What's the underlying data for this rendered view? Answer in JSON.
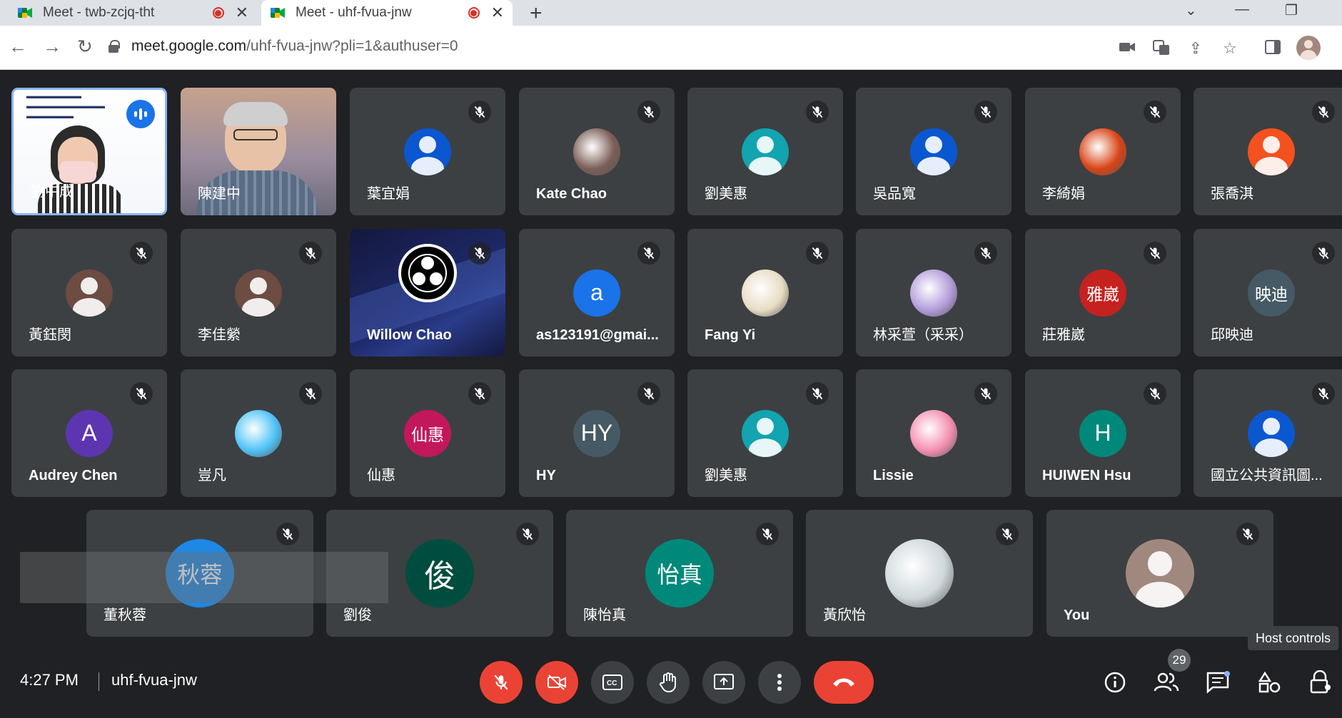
{
  "browser": {
    "tabs": [
      {
        "title": "Meet - twb-zcjq-tht",
        "active": false
      },
      {
        "title": "Meet - uhf-fvua-jnw",
        "active": true
      }
    ],
    "url_host": "meet.google.com",
    "url_path": "/uhf-fvua-jnw?pli=1&authuser=0"
  },
  "meeting": {
    "time": "4:27 PM",
    "code": "uhf-fvua-jnw",
    "participant_count": "29",
    "tooltip": "Host controls"
  },
  "colors": {
    "background": "#202124",
    "tile": "#3c4043",
    "accent": "#1a73e8",
    "danger": "#ea4335"
  },
  "participants": {
    "row1": [
      {
        "name": "劉中成",
        "kind": "video-slide",
        "speaking": true
      },
      {
        "name": "陳建中",
        "kind": "video-person"
      },
      {
        "name": "葉宜娟",
        "kind": "avatar",
        "color": "#0b57d0",
        "icon": "person-icon"
      },
      {
        "name": "Kate Chao",
        "kind": "photo",
        "color": "#7b5e57",
        "icon": "profile-photo-icon"
      },
      {
        "name": "劉美惠",
        "kind": "avatar",
        "color": "#12a4af",
        "icon": "person-icon"
      },
      {
        "name": "吳品寬",
        "kind": "avatar",
        "color": "#0b57d0",
        "icon": "person-icon"
      },
      {
        "name": "李綺娟",
        "kind": "photo",
        "color": "#d84315",
        "icon": "flower-photo-icon"
      },
      {
        "name": "張喬淇",
        "kind": "avatar",
        "color": "#f4511e",
        "icon": "person-icon"
      }
    ],
    "row2": [
      {
        "name": "黃鈺閔",
        "kind": "avatar",
        "color": "#6d4c41",
        "icon": "person-icon"
      },
      {
        "name": "李佳縈",
        "kind": "avatar",
        "color": "#6d4c41",
        "icon": "person-icon"
      },
      {
        "name": "Willow Chao",
        "kind": "obs",
        "icon": "obs-logo-icon"
      },
      {
        "name": "as123191@gmai...",
        "kind": "letter",
        "letter": "a",
        "color": "#1a73e8"
      },
      {
        "name": "Fang Yi",
        "kind": "photo",
        "color": "#e8dcc4",
        "icon": "cartoon-photo-icon"
      },
      {
        "name": "林采萱（采采）",
        "kind": "photo",
        "color": "#b39ddb",
        "icon": "anime-photo-icon"
      },
      {
        "name": "莊雅崴",
        "kind": "letter",
        "letter": "雅崴",
        "color": "#c5221f"
      },
      {
        "name": "邱映迪",
        "kind": "letter",
        "letter": "映迪",
        "color": "#455a64"
      }
    ],
    "row3": [
      {
        "name": "Audrey Chen",
        "kind": "letter",
        "letter": "A",
        "color": "#5e35b1"
      },
      {
        "name": "豈凡",
        "kind": "photo",
        "color": "#4fc3f7",
        "icon": "globe-photo-icon"
      },
      {
        "name": "仙惠",
        "kind": "letter",
        "letter": "仙惠",
        "color": "#c2185b"
      },
      {
        "name": "HY",
        "kind": "letter",
        "letter": "HY",
        "color": "#455a64"
      },
      {
        "name": "劉美惠",
        "kind": "avatar",
        "color": "#12a4af",
        "icon": "person-icon"
      },
      {
        "name": "Lissie",
        "kind": "photo",
        "color": "#f48fb1",
        "icon": "cat-photo-icon"
      },
      {
        "name": "HUIWEN Hsu",
        "kind": "letter",
        "letter": "H",
        "color": "#00897b"
      },
      {
        "name": "國立公共資訊圖...",
        "kind": "avatar",
        "color": "#0b57d0",
        "icon": "person-icon"
      }
    ],
    "row4": [
      {
        "name": "董秋蓉",
        "kind": "letter",
        "letter": "秋蓉",
        "color": "#1e88e5"
      },
      {
        "name": "劉俊",
        "kind": "letter",
        "letter": "俊",
        "color": "#004d40"
      },
      {
        "name": "陳怡真",
        "kind": "letter",
        "letter": "怡真",
        "color": "#00897b"
      },
      {
        "name": "黃欣怡",
        "kind": "photo",
        "color": "#cfd8dc",
        "icon": "floral-photo-icon"
      },
      {
        "name": "You",
        "kind": "avatar",
        "color": "#a1887f",
        "icon": "person-icon"
      }
    ]
  }
}
